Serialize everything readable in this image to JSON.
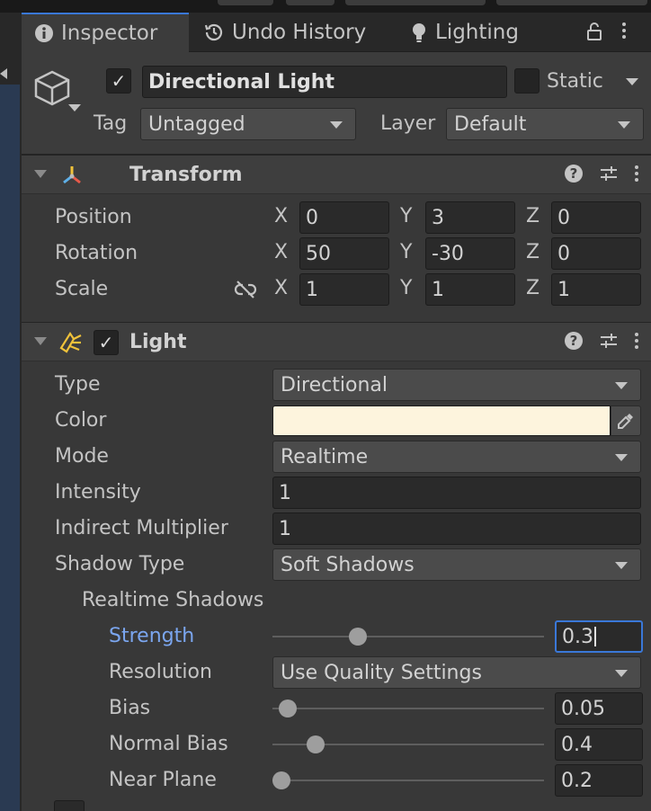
{
  "tabs": [
    {
      "label": "Inspector",
      "icon": "info-icon",
      "active": true
    },
    {
      "label": "Undo History",
      "icon": "history-icon",
      "active": false
    },
    {
      "label": "Lighting",
      "icon": "lightbulb-icon",
      "active": false
    }
  ],
  "header": {
    "object_name": "Directional Light",
    "active_checked": true,
    "static_label": "Static",
    "static_checked": false,
    "tag_label": "Tag",
    "tag_value": "Untagged",
    "layer_label": "Layer",
    "layer_value": "Default"
  },
  "transform": {
    "title": "Transform",
    "rows": [
      {
        "label": "Position",
        "x": "0",
        "y": "3",
        "z": "0"
      },
      {
        "label": "Rotation",
        "x": "50",
        "y": "-30",
        "z": "0"
      },
      {
        "label": "Scale",
        "x": "1",
        "y": "1",
        "z": "1"
      }
    ],
    "axis": {
      "x": "X",
      "y": "Y",
      "z": "Z"
    }
  },
  "light": {
    "title": "Light",
    "enabled": true,
    "type_label": "Type",
    "type_value": "Directional",
    "color_label": "Color",
    "color_value": "#fdf4dd",
    "mode_label": "Mode",
    "mode_value": "Realtime",
    "intensity_label": "Intensity",
    "intensity_value": "1",
    "indirect_label": "Indirect Multiplier",
    "indirect_value": "1",
    "shadow_type_label": "Shadow Type",
    "shadow_type_value": "Soft Shadows",
    "realtime_shadows_label": "Realtime Shadows",
    "strength_label": "Strength",
    "strength_value": "0.3",
    "strength_fraction": 0.3,
    "resolution_label": "Resolution",
    "resolution_value": "Use Quality Settings",
    "bias_label": "Bias",
    "bias_value": "0.05",
    "bias_fraction": 0.025,
    "normal_bias_label": "Normal Bias",
    "normal_bias_value": "0.4",
    "normal_bias_fraction": 0.133,
    "near_plane_label": "Near Plane",
    "near_plane_value": "0.2",
    "near_plane_fraction": 0.0
  },
  "colors": {
    "accent": "#3a78d8",
    "focused_label": "#7ba6ef"
  }
}
